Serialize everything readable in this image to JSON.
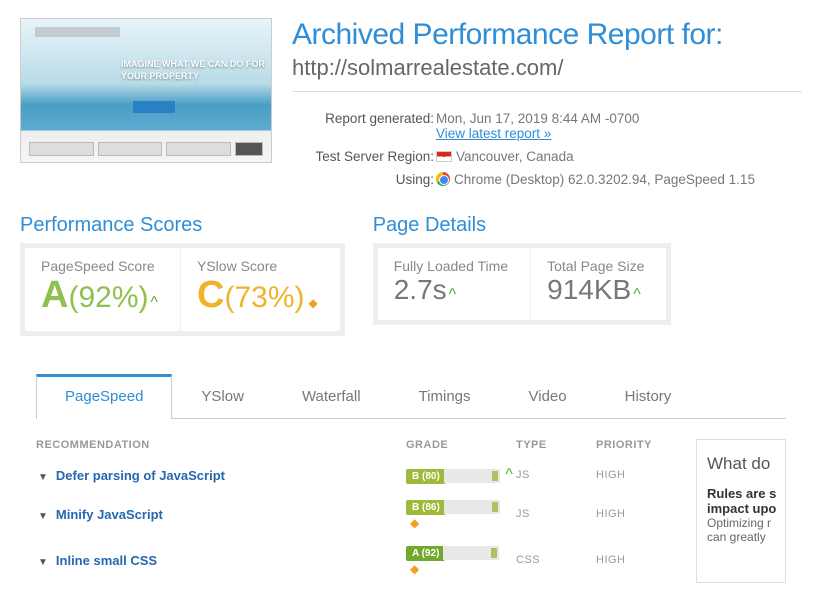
{
  "header": {
    "title": "Archived Performance Report for:",
    "url": "http://solmarrealestate.com/",
    "thumb_text": "IMAGINE WHAT WE CAN DO FOR YOUR PROPERTY"
  },
  "meta": {
    "generated_label": "Report generated:",
    "generated_value": "Mon, Jun 17, 2019 8:44 AM -0700",
    "latest_link": "View latest report »",
    "region_label": "Test Server Region:",
    "region_value": "Vancouver, Canada",
    "using_label": "Using:",
    "using_value": "Chrome (Desktop) 62.0.3202.94, PageSpeed 1.15"
  },
  "scores": {
    "section_title": "Performance Scores",
    "pagespeed_label": "PageSpeed Score",
    "pagespeed_grade": "A",
    "pagespeed_pct": "(92%)",
    "yslow_label": "YSlow Score",
    "yslow_grade": "C",
    "yslow_pct": "(73%)"
  },
  "details": {
    "section_title": "Page Details",
    "loaded_label": "Fully Loaded Time",
    "loaded_value": "2.7s",
    "size_label": "Total Page Size",
    "size_value": "914KB"
  },
  "tabs": [
    "PageSpeed",
    "YSlow",
    "Waterfall",
    "Timings",
    "Video",
    "History"
  ],
  "table": {
    "headers": {
      "rec": "Recommendation",
      "grade": "Grade",
      "type": "Type",
      "prio": "Priority"
    },
    "rows": [
      {
        "name": "Defer parsing of JavaScript",
        "grade": "B (80)",
        "grade_class": "grade-B",
        "arrow": "up",
        "type": "JS",
        "prio": "HIGH"
      },
      {
        "name": "Minify JavaScript",
        "grade": "B (86)",
        "grade_class": "grade-B",
        "arrow": "diamond",
        "type": "JS",
        "prio": "HIGH"
      },
      {
        "name": "Inline small CSS",
        "grade": "A (92)",
        "grade_class": "grade-Ab",
        "arrow": "diamond",
        "type": "CSS",
        "prio": "HIGH"
      }
    ]
  },
  "side": {
    "title": "What do",
    "bold": "Rules are s",
    "bold2": "impact upo",
    "text": "Optimizing r",
    "text2": "can greatly"
  }
}
